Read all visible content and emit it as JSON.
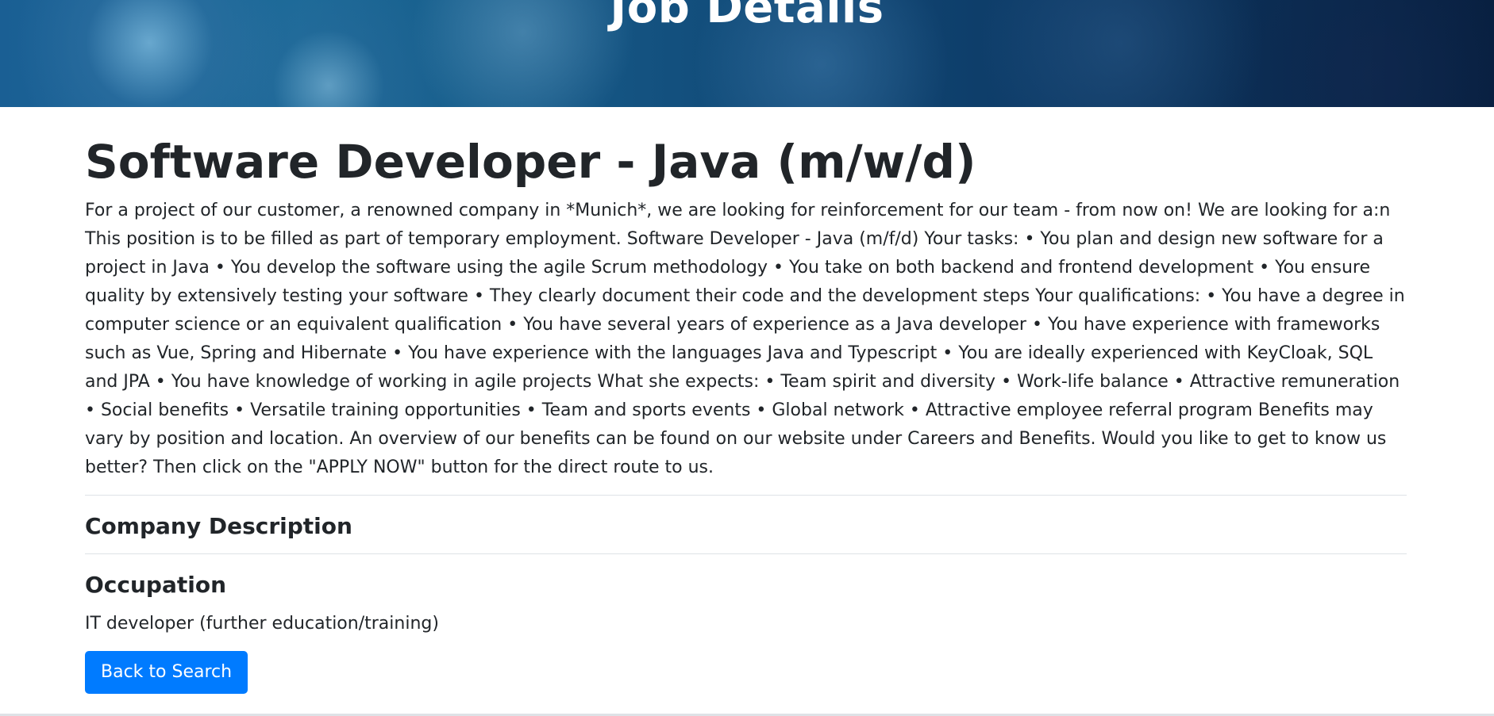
{
  "header": {
    "title": "Job Details"
  },
  "job": {
    "title": "Software Developer - Java (m/w/d)",
    "description": "For a project of our customer, a renowned company in *Munich*, we are looking for reinforcement for our team - from now on! We are looking for a:n This position is to be filled as part of temporary employment. Software Developer - Java (m/f/d) Your tasks: • You plan and design new software for a project in Java • You develop the software using the agile Scrum methodology • You take on both backend and frontend development • You ensure quality by extensively testing your software • They clearly document their code and the development steps Your qualifications: • You have a degree in computer science or an equivalent qualification • You have several years of experience as a Java developer • You have experience with frameworks such as Vue, Spring and Hibernate • You have experience with the languages Java and Typescript • You are ideally experienced with KeyCloak, SQL and JPA • You have knowledge of working in agile projects What she expects: • Team spirit and diversity • Work-life balance • Attractive remuneration • Social benefits • Versatile training opportunities • Team and sports events • Global network • Attractive employee referral program Benefits may vary by position and location. An overview of our benefits can be found on our website under Careers and Benefits. Would you like to get to know us better? Then click on the \"APPLY NOW\" button for the direct route to us."
  },
  "company_description": {
    "heading": "Company Description"
  },
  "occupation": {
    "heading": "Occupation",
    "value": "IT developer (further education/training)"
  },
  "actions": {
    "back_label": "Back to Search"
  },
  "colors": {
    "primary_button": "#007bff",
    "text": "#212529",
    "divider": "#dee2e6"
  }
}
